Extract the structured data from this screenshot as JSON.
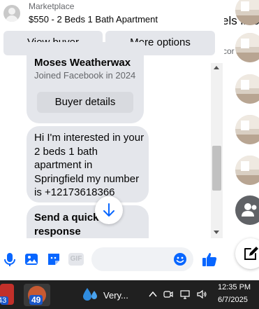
{
  "header": {
    "subtitle": "Marketplace",
    "title": "$550 - 2 Beds 1 Bath Apartment"
  },
  "actions": {
    "view_buyer": "View buyer",
    "more_options": "More options"
  },
  "buyer_card": {
    "name": "Moses Weatherwax",
    "joined": "Joined Facebook in 2024",
    "details_button": "Buyer details"
  },
  "messages": [
    "Hi I'm interested in your 2 beds 1 bath apartment in Springfield my number is +12173618366"
  ],
  "quick_response": "Send a quick response",
  "compose": {
    "icons": [
      "microphone-icon",
      "photo-icon",
      "sticker-icon",
      "gif-icon",
      "emoji-icon",
      "thumbs-up-icon"
    ],
    "gif_label": "GIF",
    "input_placeholder": ""
  },
  "right_panel": {
    "partial_text_1": "els into",
    "partial_text_2": "cor"
  },
  "taskbar": {
    "app1_badge": "43",
    "app2_badge": "49",
    "weather_text": "Very...",
    "time": "12:35 PM",
    "date": "6/7/2025"
  },
  "colors": {
    "accent": "#0866ff",
    "bubble": "#e4e6eb",
    "taskbar": "#202020"
  }
}
